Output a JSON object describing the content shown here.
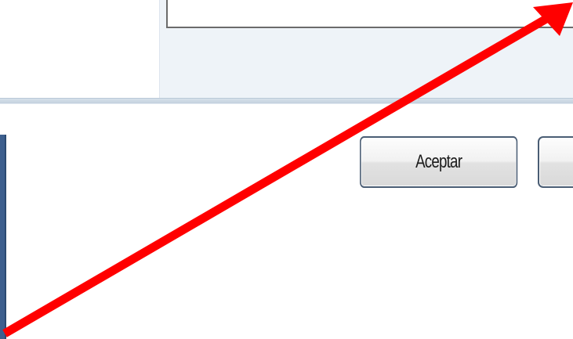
{
  "dialog": {
    "accept_label": "Aceptar",
    "cancel_label": ""
  },
  "annotation": {
    "arrow_color": "#ff0000"
  }
}
